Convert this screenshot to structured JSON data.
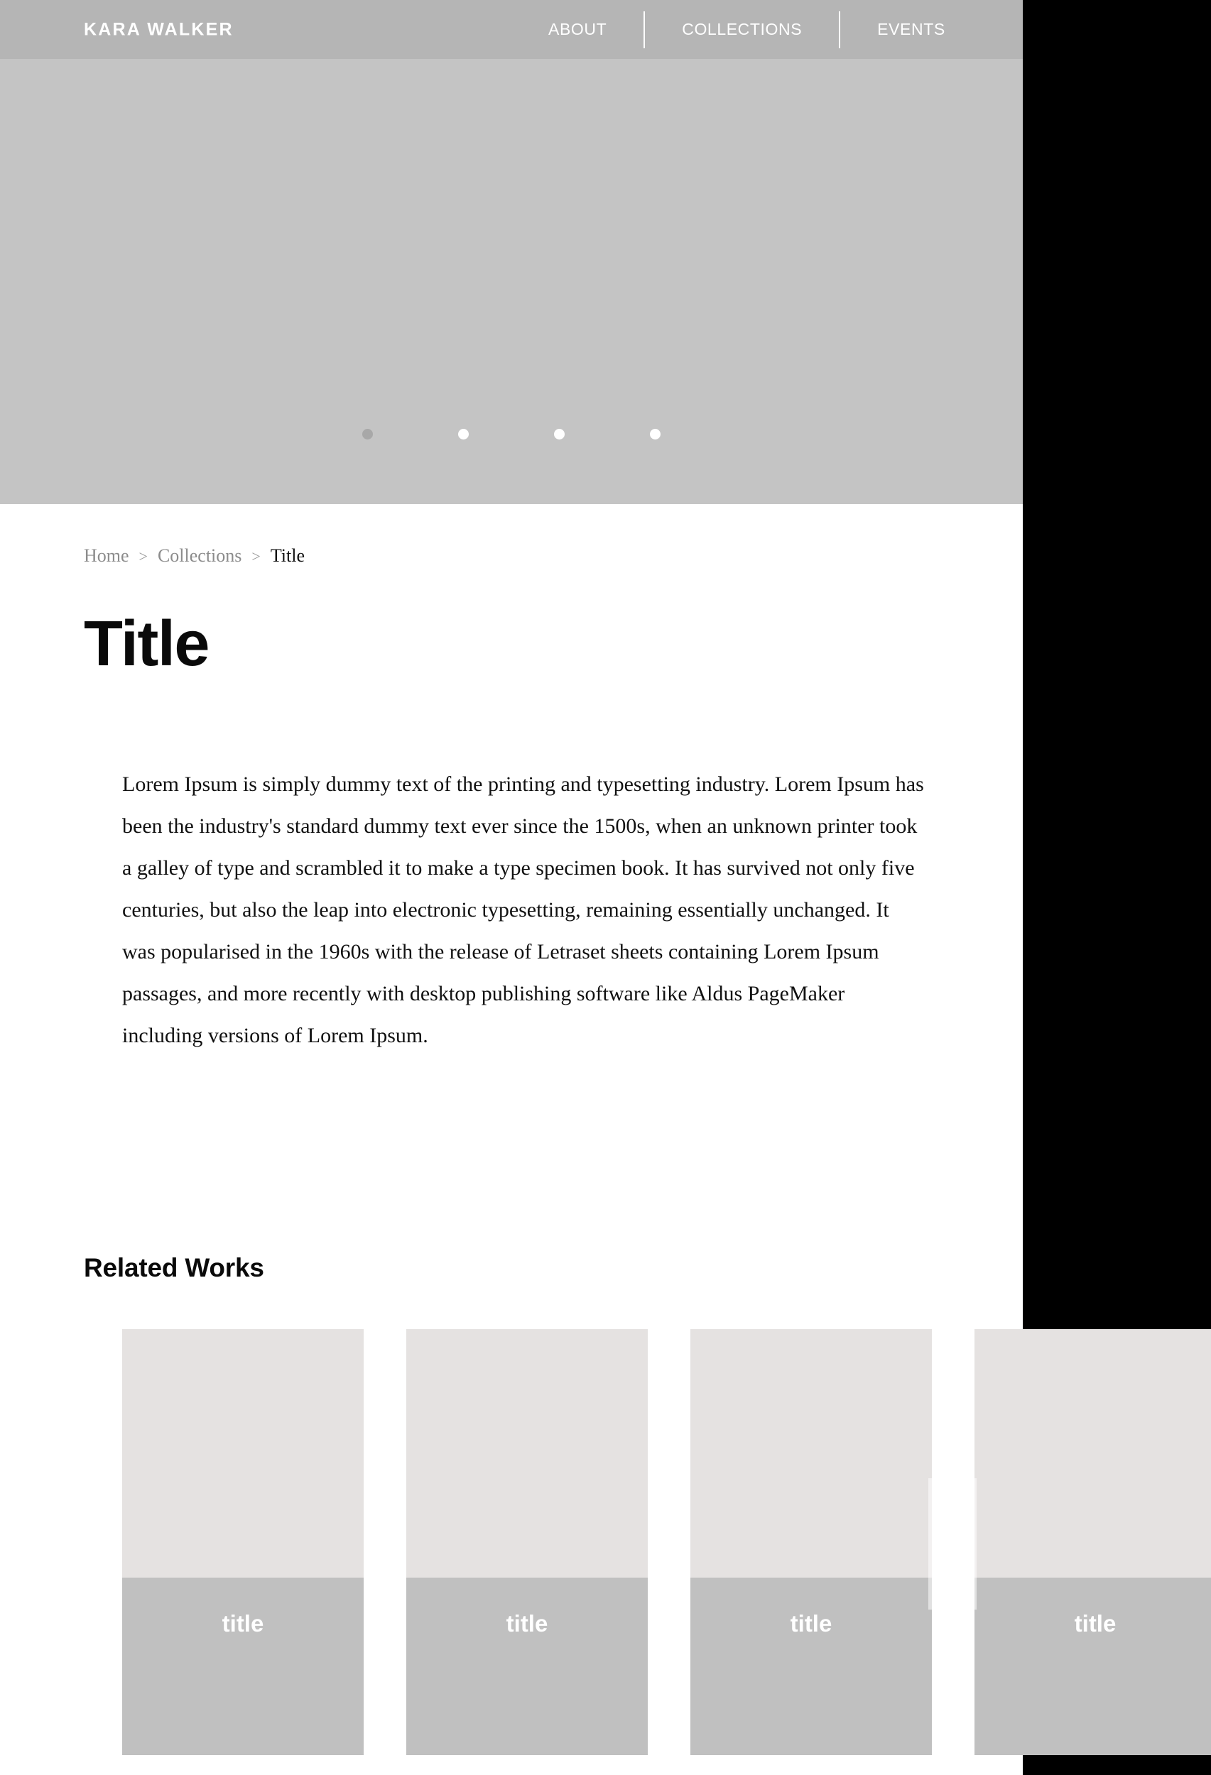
{
  "header": {
    "brand": "KARA WALKER",
    "nav": [
      {
        "label": "ABOUT"
      },
      {
        "label": "COLLECTIONS"
      },
      {
        "label": "EVENTS"
      }
    ]
  },
  "hero": {
    "dots": [
      {
        "state": "active"
      },
      {
        "state": "inactive"
      },
      {
        "state": "inactive"
      },
      {
        "state": "inactive"
      }
    ]
  },
  "breadcrumb": {
    "items": [
      {
        "label": "Home",
        "current": false
      },
      {
        "label": "Collections",
        "current": false
      },
      {
        "label": "Title",
        "current": true
      }
    ],
    "separator": ">"
  },
  "main": {
    "title": "Title",
    "body": "Lorem Ipsum is simply dummy text of the printing and typesetting industry. Lorem Ipsum has been the industry's standard dummy text ever since the 1500s, when an unknown printer took a galley of type and scrambled it to make a type specimen book. It has survived not only five centuries, but also the leap into electronic typesetting, remaining essentially unchanged. It was popularised in the 1960s with the release of Letraset sheets containing Lorem Ipsum passages, and more recently with desktop publishing software like Aldus PageMaker including versions of Lorem Ipsum."
  },
  "related": {
    "heading": "Related Works",
    "next_label": "→",
    "cards": [
      {
        "title": "title"
      },
      {
        "title": "title"
      },
      {
        "title": "title"
      },
      {
        "title": "title"
      }
    ]
  },
  "colors": {
    "header_bg": "#b5b5b5",
    "hero_bg": "#c4c4c4",
    "page_bg": "#ffffff",
    "outside_bg": "#000000",
    "card_thumb": "#e5e2e1",
    "card_caption": "#c0c0c0",
    "text_dark": "#111111",
    "text_muted": "#8c8c8c",
    "text_on_dark": "#ffffff"
  }
}
